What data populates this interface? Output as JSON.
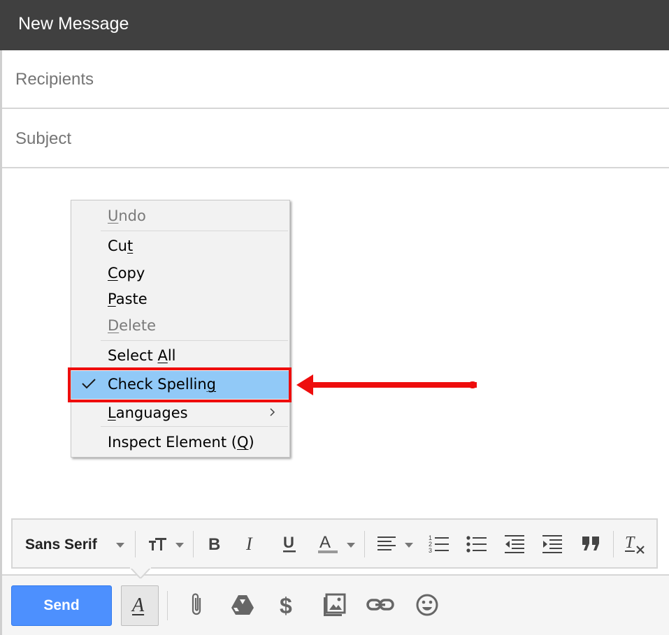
{
  "window": {
    "title": "New Message"
  },
  "fields": {
    "recipients_placeholder": "Recipients",
    "subject_placeholder": "Subject"
  },
  "context_menu": {
    "items": [
      {
        "pre": "",
        "key": "U",
        "post": "ndo",
        "disabled": true
      },
      {
        "pre": "Cu",
        "key": "t",
        "post": "",
        "disabled": false
      },
      {
        "pre": "",
        "key": "C",
        "post": "opy",
        "disabled": false
      },
      {
        "pre": "",
        "key": "P",
        "post": "aste",
        "disabled": false
      },
      {
        "pre": "",
        "key": "D",
        "post": "elete",
        "disabled": true
      },
      {
        "pre": "Select ",
        "key": "A",
        "post": "ll",
        "disabled": false
      },
      {
        "pre": "Check Spellin",
        "key": "g",
        "post": "",
        "disabled": false,
        "checked": true,
        "highlighted": true
      },
      {
        "pre": "",
        "key": "L",
        "post": "anguages",
        "disabled": false,
        "submenu": true
      },
      {
        "pre": "Inspect Element (",
        "key": "Q",
        "post": ")",
        "disabled": false
      }
    ]
  },
  "format_toolbar": {
    "font": "Sans Serif",
    "icons": [
      "text-size-icon",
      "bold-icon",
      "italic-icon",
      "underline-icon",
      "text-color-icon",
      "align-icon",
      "numbered-list-icon",
      "bulleted-list-icon",
      "indent-less-icon",
      "indent-more-icon",
      "quote-icon",
      "remove-formatting-icon"
    ]
  },
  "bottom_bar": {
    "send_label": "Send",
    "format_toggle_glyph": "A",
    "icons": [
      "attach-icon",
      "drive-icon",
      "money-icon",
      "photo-icon",
      "link-icon",
      "emoji-icon"
    ]
  },
  "colors": {
    "titlebar": "#404040",
    "send_button": "#4d90fe",
    "menu_highlight": "#91c9f7",
    "annotation_red": "#ee0d0d"
  }
}
